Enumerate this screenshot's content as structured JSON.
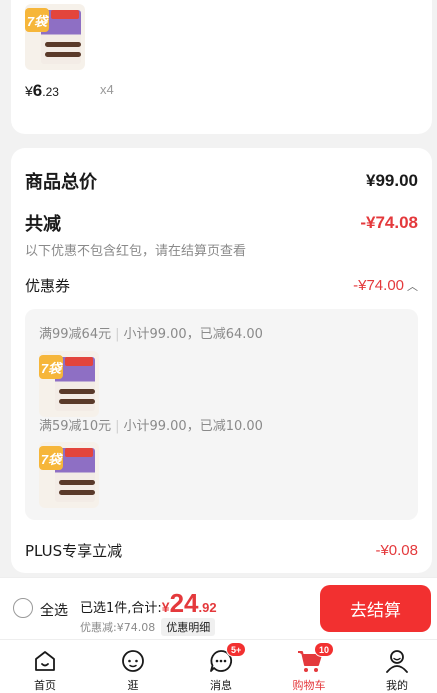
{
  "top_item": {
    "thumb_badge": "7袋",
    "price_symbol": "¥",
    "price_int": "6",
    "price_dec": ".23",
    "quantity": "x4",
    "progress_fraction": 0.55
  },
  "summary": {
    "goods_total_label": "商品总价",
    "goods_total_value": "¥99.00",
    "reduction_label": "共减",
    "reduction_value": "-¥74.08",
    "note": "以下优惠不包含红包，请在结算页查看",
    "coupon_label": "优惠券",
    "coupon_value": "-¥74.00",
    "coupons": [
      {
        "title": "满99减64元",
        "detail": "小计99.00，已减64.00",
        "thumb_badge": "7袋"
      },
      {
        "title": "满59减10元",
        "detail": "小计99.00，已减10.00",
        "thumb_badge": "7袋"
      }
    ],
    "plus_label": "PLUS专享立减",
    "plus_value": "-¥0.08"
  },
  "bottom_bar": {
    "select_all": "全选",
    "selected_sum_label": "已选1件,合计:",
    "sum_symbol": "¥",
    "sum_int": "24",
    "sum_dec": ".92",
    "discount_text": "优惠减:¥74.08",
    "discount_detail": "优惠明细",
    "checkout": "去结算"
  },
  "tabbar": [
    {
      "label": "首页",
      "icon": "home-icon"
    },
    {
      "label": "逛",
      "icon": "face-icon"
    },
    {
      "label": "消息",
      "icon": "message-icon",
      "badge": "5+"
    },
    {
      "label": "购物车",
      "icon": "cart-icon",
      "badge": "10",
      "active": true
    },
    {
      "label": "我的",
      "icon": "user-icon"
    }
  ],
  "colors": {
    "accent": "#e4393c",
    "button": "#f23030"
  }
}
